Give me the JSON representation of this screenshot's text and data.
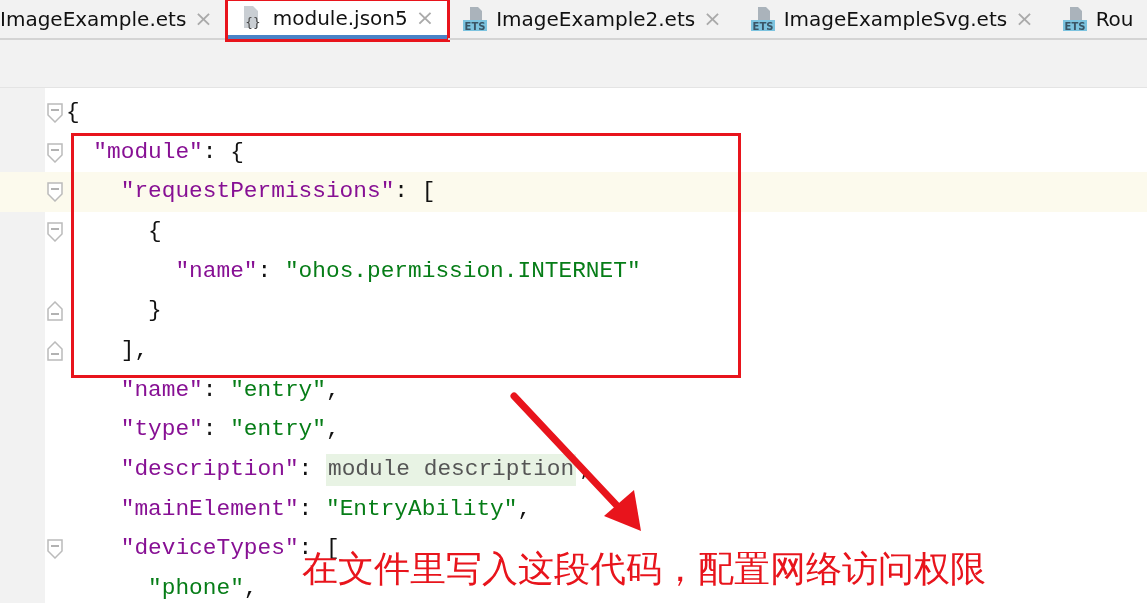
{
  "tabs": [
    {
      "label": "ImageExample.ets",
      "kind": "none",
      "selected": false,
      "closable": true
    },
    {
      "label": "module.json5",
      "kind": "json",
      "icon_text": "{}",
      "selected": true,
      "closable": true
    },
    {
      "label": "ImageExample2.ets",
      "kind": "ets",
      "icon_text": "ETS",
      "selected": false,
      "closable": true
    },
    {
      "label": "ImageExampleSvg.ets",
      "kind": "ets",
      "icon_text": "ETS",
      "selected": false,
      "closable": true
    },
    {
      "label": "Rou",
      "kind": "ets",
      "icon_text": "ETS",
      "selected": false,
      "closable": false
    }
  ],
  "close_glyph": "×",
  "editor": {
    "lines": [
      {
        "fold_start": true,
        "fold_end": false,
        "current": false,
        "tokens": [
          {
            "kind": "punct",
            "text": "{"
          }
        ]
      },
      {
        "fold_start": true,
        "fold_end": false,
        "current": false,
        "tokens": [
          {
            "kind": "key",
            "text": "  \"module\""
          },
          {
            "kind": "punct",
            "text": ": {"
          }
        ]
      },
      {
        "fold_start": true,
        "fold_end": false,
        "current": true,
        "tokens": [
          {
            "kind": "key",
            "text": "    \"requestPermissions\""
          },
          {
            "kind": "punct",
            "text": ": ["
          }
        ]
      },
      {
        "fold_start": true,
        "fold_end": false,
        "current": false,
        "tokens": [
          {
            "kind": "punct",
            "text": "      {"
          }
        ]
      },
      {
        "fold_start": false,
        "fold_end": false,
        "current": false,
        "tokens": [
          {
            "kind": "key",
            "text": "        \"name\""
          },
          {
            "kind": "punct",
            "text": ": "
          },
          {
            "kind": "string",
            "text": "\"ohos.permission.INTERNET\""
          }
        ]
      },
      {
        "fold_start": false,
        "fold_end": true,
        "current": false,
        "tokens": [
          {
            "kind": "punct",
            "text": "      }"
          }
        ]
      },
      {
        "fold_start": false,
        "fold_end": true,
        "current": false,
        "tokens": [
          {
            "kind": "punct",
            "text": "    ],"
          }
        ]
      },
      {
        "fold_start": false,
        "fold_end": false,
        "current": false,
        "tokens": [
          {
            "kind": "key",
            "text": "    \"name\""
          },
          {
            "kind": "punct",
            "text": ": "
          },
          {
            "kind": "string",
            "text": "\"entry\""
          },
          {
            "kind": "punct",
            "text": ","
          }
        ]
      },
      {
        "fold_start": false,
        "fold_end": false,
        "current": false,
        "tokens": [
          {
            "kind": "key",
            "text": "    \"type\""
          },
          {
            "kind": "punct",
            "text": ": "
          },
          {
            "kind": "string",
            "text": "\"entry\""
          },
          {
            "kind": "punct",
            "text": ","
          }
        ]
      },
      {
        "fold_start": false,
        "fold_end": false,
        "current": false,
        "tokens": [
          {
            "kind": "key",
            "text": "    \"description\""
          },
          {
            "kind": "punct",
            "text": ": "
          },
          {
            "kind": "hint",
            "text": "module description"
          },
          {
            "kind": "punct",
            "text": ","
          }
        ]
      },
      {
        "fold_start": false,
        "fold_end": false,
        "current": false,
        "tokens": [
          {
            "kind": "key",
            "text": "    \"mainElement\""
          },
          {
            "kind": "punct",
            "text": ": "
          },
          {
            "kind": "string",
            "text": "\"EntryAbility\""
          },
          {
            "kind": "punct",
            "text": ","
          }
        ]
      },
      {
        "fold_start": true,
        "fold_end": false,
        "current": false,
        "tokens": [
          {
            "kind": "key",
            "text": "    \"deviceTypes\""
          },
          {
            "kind": "punct",
            "text": ": ["
          }
        ]
      },
      {
        "fold_start": false,
        "fold_end": false,
        "current": false,
        "tokens": [
          {
            "kind": "string",
            "text": "      \"phone\""
          },
          {
            "kind": "punct",
            "text": ","
          }
        ]
      }
    ]
  },
  "annotation": {
    "text": "在文件里写入这段代码，配置网络访问权限"
  }
}
